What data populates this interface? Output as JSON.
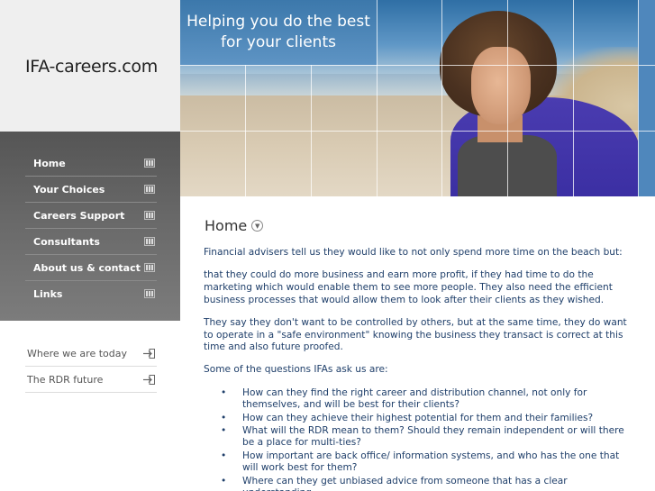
{
  "site": {
    "logo": "IFA-careers.com"
  },
  "banner": {
    "headline_line1": "Helping you do the best",
    "headline_line2": "for your clients"
  },
  "nav": {
    "items": [
      {
        "label": "Home"
      },
      {
        "label": "Your Choices"
      },
      {
        "label": "Careers Support"
      },
      {
        "label": "Consultants"
      },
      {
        "label": "About us & contact"
      },
      {
        "label": "Links"
      }
    ]
  },
  "sub_nav": {
    "items": [
      {
        "label": "Where we are today"
      },
      {
        "label": "The RDR future"
      }
    ]
  },
  "main": {
    "title": "Home",
    "paragraphs": [
      "Financial advisers tell us they would like to not only spend more time on the beach but:",
      "that they could do more business and earn more profit, if they had time to do the marketing which would enable them to see more people.  They also need the efficient business processes that would allow them to look after their clients as they wished.",
      "They say they don't want to be controlled by others, but at the same time, they do want to operate in a \"safe environment\" knowing the business they transact is correct at this time and also future proofed.",
      "Some of the questions IFAs ask us are:"
    ],
    "questions": [
      "How can they find the right career and distribution channel, not only for themselves, and will be best for their clients?",
      "How can they achieve their highest potential for them and their families?",
      "What will the RDR mean to them?  Should they remain independent or will there be a place for multi-ties?",
      "How important are back office/ information systems, and who has the one that will work best for them?",
      "Where can they get unbiased advice from someone that has a clear understanding"
    ]
  },
  "colors": {
    "nav_bg": "#666666",
    "text_blue": "#1f3f6a",
    "banner_blue": "#3c78ab"
  }
}
